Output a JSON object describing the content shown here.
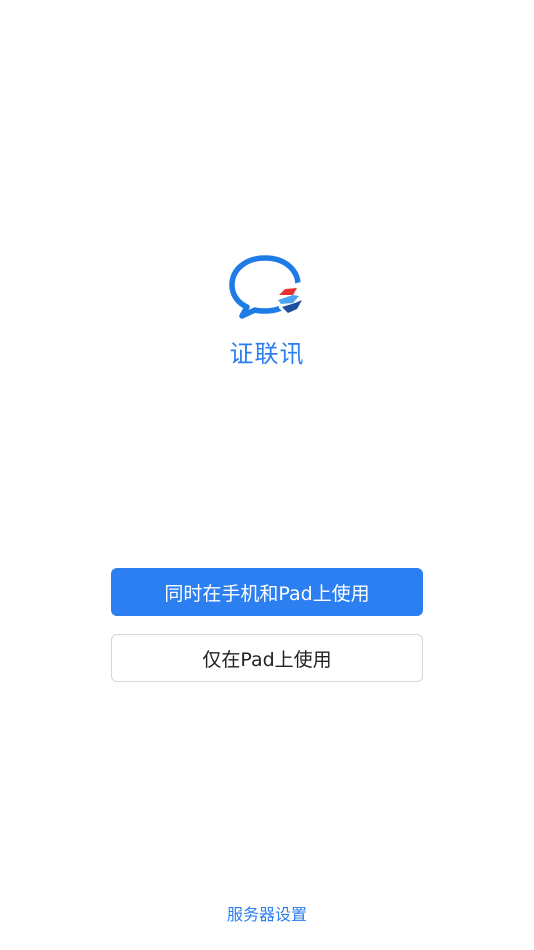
{
  "app": {
    "name": "证联讯",
    "logo_icon": "chat-bubble-logo-icon",
    "accent_color": "#2b7ff0"
  },
  "actions": {
    "primary_label": "同时在手机和Pad上使用",
    "secondary_label": "仅在Pad上使用"
  },
  "footer": {
    "server_settings_label": "服务器设置"
  }
}
